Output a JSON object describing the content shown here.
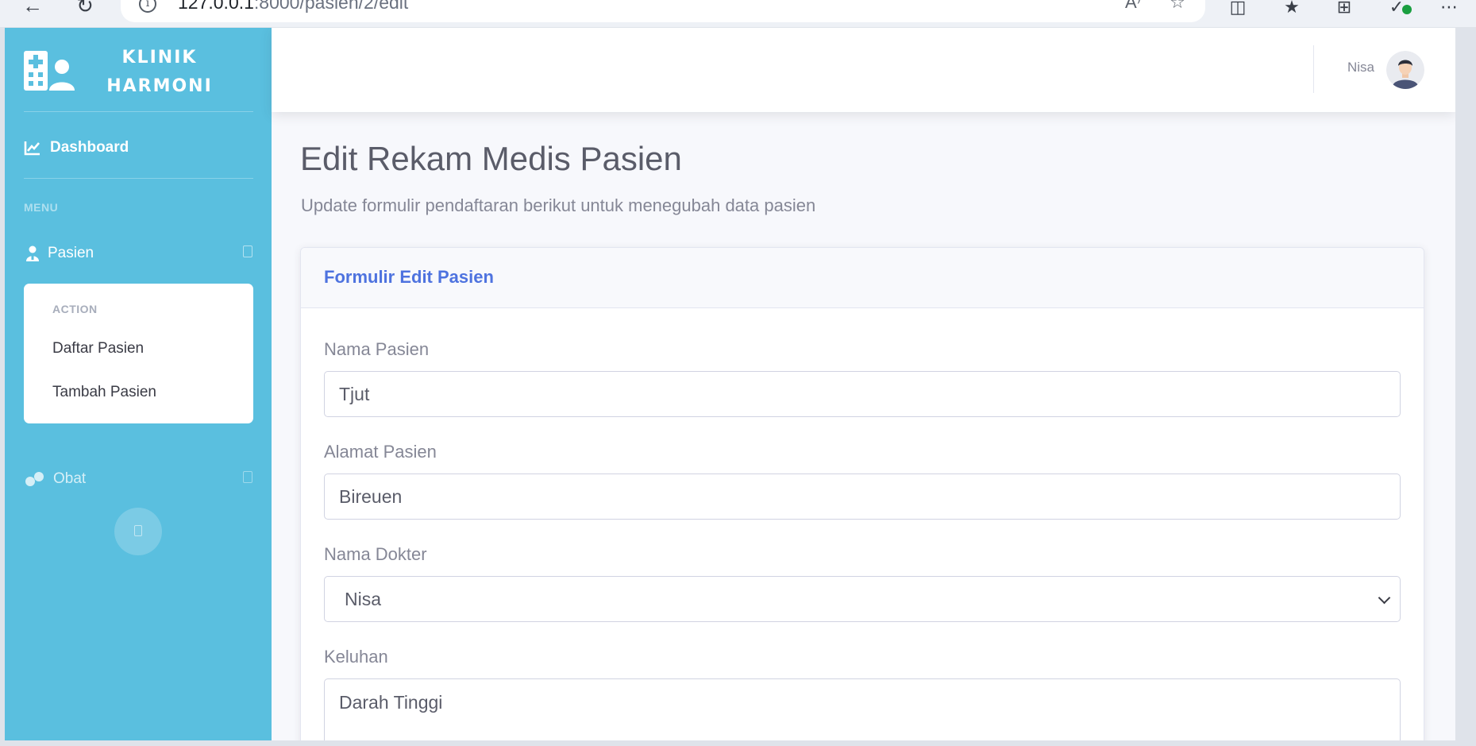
{
  "browser": {
    "url_host": "127.0.0.1",
    "url_path": ":8000/pasien/2/edit",
    "back_icon": "arrow-left-icon",
    "reload_icon": "reload-icon"
  },
  "sidebar": {
    "brand_line1": "KLINIK",
    "brand_line2": "HARMONI",
    "dashboard_label": "Dashboard",
    "menu_heading": "MENU",
    "pasien_label": "Pasien",
    "submenu": {
      "heading": "ACTION",
      "items": [
        {
          "label": "Daftar Pasien"
        },
        {
          "label": "Tambah Pasien"
        }
      ]
    },
    "obat_label": "Obat",
    "bg_color": "#5abfdf"
  },
  "topbar": {
    "user_name": "Nisa"
  },
  "page": {
    "title": "Edit Rekam Medis Pasien",
    "subtitle": "Update formulir pendaftaran berikut untuk menegubah data pasien"
  },
  "form": {
    "card_title": "Formulir Edit Pasien",
    "accent_color": "#4e73df",
    "fields": {
      "nama_pasien": {
        "label": "Nama Pasien",
        "value": "Tjut"
      },
      "alamat_pasien": {
        "label": "Alamat Pasien",
        "value": "Bireuen"
      },
      "nama_dokter": {
        "label": "Nama Dokter",
        "value": "Nisa"
      },
      "keluhan": {
        "label": "Keluhan",
        "value": "Darah Tinggi"
      }
    }
  }
}
